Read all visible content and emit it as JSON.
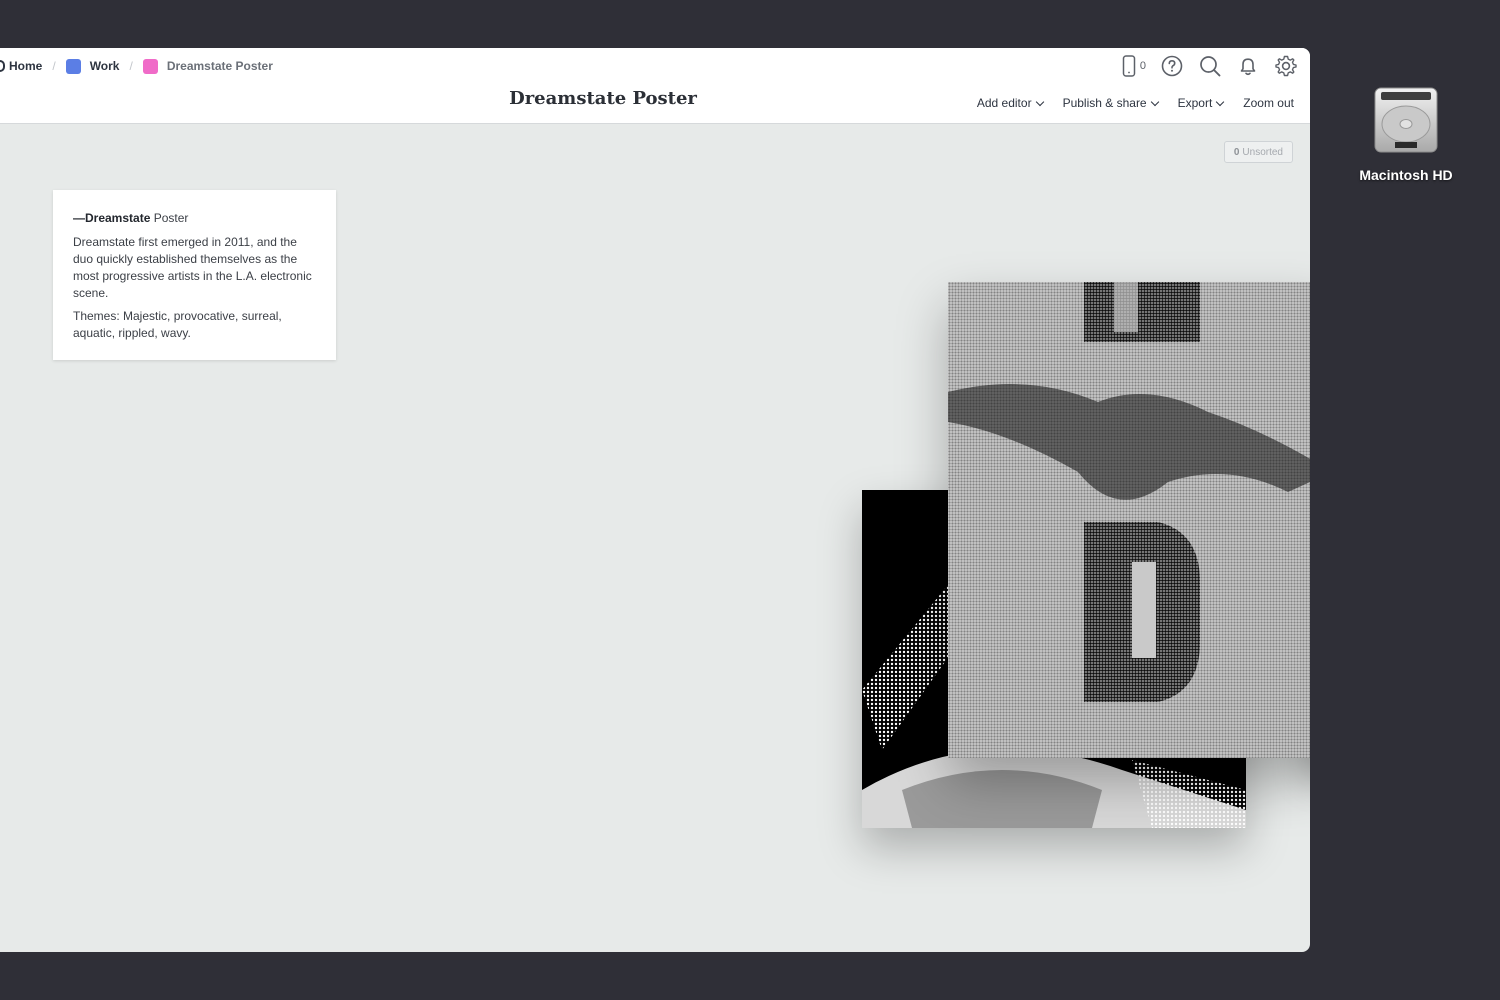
{
  "breadcrumb": {
    "items": [
      {
        "label": "Home"
      },
      {
        "label": "Work",
        "color": "#5b7ee5"
      },
      {
        "label": "Dreamstate Poster",
        "color": "#f06bc8"
      }
    ],
    "separator": "/"
  },
  "header": {
    "title": "Dreamstate Poster",
    "device_count": "0",
    "icons": [
      "phone-icon",
      "help-icon",
      "search-icon",
      "bell-icon",
      "gear-icon"
    ]
  },
  "menu": {
    "add_editor": "Add editor",
    "publish_share": "Publish & share",
    "export": "Export",
    "zoom_out": "Zoom out"
  },
  "unsorted": {
    "count": "0",
    "label": "Unsorted"
  },
  "note": {
    "dash": "—",
    "title_bold": "Dreamstate",
    "title_rest": " Poster",
    "paragraph_1": "Dreamstate first emerged in 2011, and the duo quickly established themselves as the most progressive artists in the L.A. electronic scene.",
    "paragraph_2": "Themes: Majestic, provocative, surreal, aquatic, rippled, wavy."
  },
  "desktop": {
    "disk_label": "Macintosh HD"
  },
  "colors": {
    "desktop_bg": "#2f2f37",
    "canvas_bg": "#e7eae9",
    "work_swatch": "#5b7ee5",
    "poster_swatch": "#f06bc8"
  }
}
